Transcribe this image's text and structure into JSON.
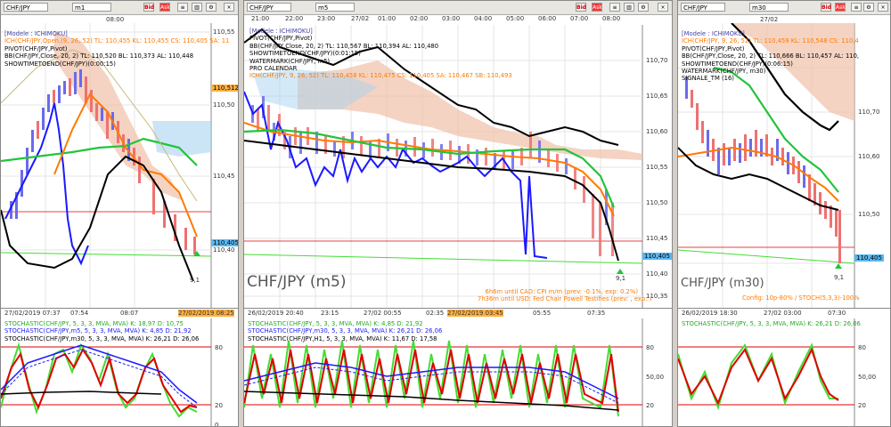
{
  "colors": {
    "blue": "#1a1aff",
    "orange": "#ff7a00",
    "green": "#22c43a",
    "black": "#000000",
    "red": "#e00000",
    "limegreen": "#44dd33",
    "cloud": "#f0c0a8"
  },
  "panels": [
    {
      "symbol": "CHF/JPY",
      "timeframe": "m1",
      "clock": "08:00",
      "bid": "Bid",
      "ask": "Ask",
      "info": [
        {
          "t": "[Modele : ICHIMOKU]",
          "c": "#4444aa"
        },
        {
          "t": "ICH(CHF/JPY,Open,(9, 26, 52) TL: 110,455  KL: 110,455  CS: 110,405  SA: 11",
          "c": "#ff7a00"
        },
        {
          "t": "PIVOT(CHF/JPY,Pivot)",
          "c": "#000"
        },
        {
          "t": "BB(CHF/JPY,Close, 20, 2)  TL: 110,520  BL: 110,373  AL: 110,448",
          "c": "#000"
        },
        {
          "t": "SHOWTIMETOEND(CHF/JPY)(0:00:15)",
          "c": "#000"
        }
      ],
      "yticks": [
        "110,55",
        "110,50",
        "110,45",
        "110,40"
      ],
      "pricetags": [
        {
          "v": "110,512",
          "c": "#ffb040"
        },
        {
          "v": "110,405",
          "c": "#5bb8f0"
        }
      ],
      "xlabels": [
        "27/02/2019 07:37",
        "07:54",
        "08:07",
        "27/02/2019 08:25"
      ],
      "arrowlabel": "9,1",
      "stoch": [
        {
          "t": "STOCHASTIC(CHF/JPY, 5, 3, 3, MVA, MVA)  K: 18,97  D: 10,75",
          "c": "#22aa22"
        },
        {
          "t": "STOCHASTIC(CHF/JPY,m5, 5, 3, 3, MVA, MVA)  K: 4,85  D: 21,92",
          "c": "#1a1aff"
        },
        {
          "t": "STOCHASTIC(CHF/JPY,m30, 5, 3, 3, MVA, MVA)  K: 26,21  D: 26,06",
          "c": "#000"
        }
      ],
      "stochticks": [
        "80",
        "20",
        "0"
      ]
    },
    {
      "symbol": "CHF/JPY",
      "timeframe": "m5",
      "clock": "08:00",
      "toptimes": [
        "21:00",
        "22:00",
        "23:00",
        "27/02",
        "01:00",
        "02:00",
        "03:00",
        "04:00",
        "05:00",
        "06:00",
        "07:00",
        "08:00"
      ],
      "info": [
        {
          "t": "[Modele : ICHIMOKU]",
          "c": "#4444aa"
        },
        {
          "t": "PIVOT(CHF/JPY,Pivot)",
          "c": "#000"
        },
        {
          "t": "BB(CHF/JPY,Close, 20, 2)  TL: 110,567  BL: 110,394  AL: 110,480",
          "c": "#000"
        },
        {
          "t": "SHOWTIMETOEND(CHF/JPY)(0:01:15)",
          "c": "#000"
        },
        {
          "t": "WATERMARK(CHF/JPY, m5)",
          "c": "#000"
        },
        {
          "t": "PRO CALENDAR",
          "c": "#000"
        },
        {
          "t": "ICH(CHF/JPY, 9, 26, 52)  TL: 110,458  KL: 110,475  CS: 110,405  SA: 110,467  SB: 110,493",
          "c": "#ff7a00"
        }
      ],
      "yticks": [
        "110,70",
        "110,65",
        "110,60",
        "110,55",
        "110,50",
        "110,45",
        "110,40",
        "110,35"
      ],
      "pricetags": [
        {
          "v": "110,405",
          "c": "#5bb8f0"
        }
      ],
      "watermark": "CHF/JPY (m5)",
      "calendar": [
        "6h6m until CAD: CPI m/m (prev: -0.1%, exp: 0.2%)",
        "7h36m until USD: Fed Chair Powell Testifies (prev: , exp: )"
      ],
      "xlabels": [
        "26/02/2019 20:40",
        "23:15",
        "27/02 00:55",
        "02:35",
        "27/02/2019 03:45",
        "05:55",
        "07:35"
      ],
      "arrowlabel": "9,1",
      "stoch": [
        {
          "t": "STOCHASTIC(CHF/JPY, 5, 3, 3, MVA, MVA)  K: 4,85  D: 21,92",
          "c": "#22aa22"
        },
        {
          "t": "STOCHASTIC(CHF/JPY,m30, 5, 3, 3, MVA, MVA)  K: 26,21  D: 26,06",
          "c": "#1a1aff"
        },
        {
          "t": "STOCHASTIC(CHF/JPY,H1, 5, 3, 3, MVA, MVA)  K: 11,67  D: 17,58",
          "c": "#000"
        }
      ],
      "stochticks": [
        "80",
        "50,00",
        "20"
      ]
    },
    {
      "symbol": "CHF/JPY",
      "timeframe": "m30",
      "clock": "27/02",
      "info": [
        {
          "t": "[Modele : ICHIMOKU]",
          "c": "#4444aa"
        },
        {
          "t": "ICH(CHF/JPY, 9, 26, 52)  TL: 110,459  KL: 110,548  CS: 110,4",
          "c": "#ff7a00"
        },
        {
          "t": "PIVOT(CHF/JPY,Pivot)",
          "c": "#000"
        },
        {
          "t": "BB(CHF/JPY,Close, 20, 2)  TL: 110,666  BL: 110,457  AL: 110,",
          "c": "#000"
        },
        {
          "t": "SHOWTIMETOEND(CHF/JPY)(0:06:15)",
          "c": "#000"
        },
        {
          "t": "WATERMARK(CHF/JPY, m30)",
          "c": "#000"
        },
        {
          "t": "SIGNALE_TM (16)",
          "c": "#000"
        }
      ],
      "yticks": [
        "110,70",
        "110,60",
        "110,50"
      ],
      "pricetags": [
        {
          "v": "110,405",
          "c": "#5bb8f0"
        }
      ],
      "watermark": "CHF/JPY (m30)",
      "config": "Config: 10p-80% / STOCH(5,3,3)-100%",
      "xlabels": [
        "26/02/2019 18:30",
        "27/02 03:00",
        "07:30"
      ],
      "arrowlabel": "9,1",
      "stoch": [
        {
          "t": "STOCHASTIC(CHF/JPY, 5, 3, 3, MVA, MVA)  K: 26,21  D: 26,06",
          "c": "#22aa22"
        }
      ],
      "stochticks": [
        "80",
        "50,00",
        "20"
      ]
    }
  ]
}
